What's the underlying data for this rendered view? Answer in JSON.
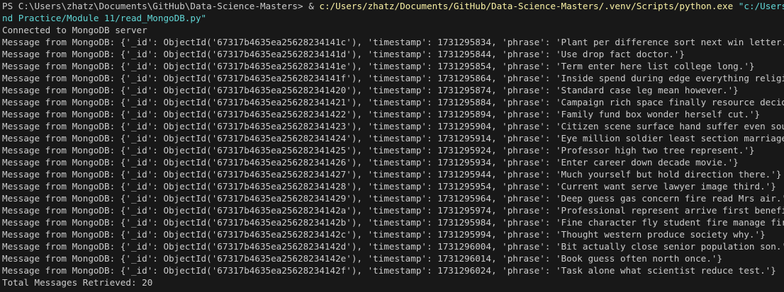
{
  "terminal": {
    "command": {
      "prompt": "PS C:\\Users\\zhatz\\Documents\\GitHub\\Data-Science-Masters> ",
      "operator": "& ",
      "executable": "c:/Users/zhatz/Documents/GitHub/Data-Science-Masters/.venv/Scripts/python.exe",
      "space": " ",
      "arg_line1": "\"c:/Users/zhatz/Docum",
      "arg_line2": "nd Practice/Module 11/read_MongoDB.py\""
    },
    "connected_text": "Connected to MongoDB server",
    "messages": [
      "Message from MongoDB: {'_id': ObjectId('67317b4635ea25628234141c'), 'timestamp': 1731295834, 'phrase': 'Plant per difference sort next win letter.'}",
      "Message from MongoDB: {'_id': ObjectId('67317b4635ea25628234141d'), 'timestamp': 1731295844, 'phrase': 'Use drop fact doctor.'}",
      "Message from MongoDB: {'_id': ObjectId('67317b4635ea25628234141e'), 'timestamp': 1731295854, 'phrase': 'Term enter here list college long.'}",
      "Message from MongoDB: {'_id': ObjectId('67317b4635ea25628234141f'), 'timestamp': 1731295864, 'phrase': 'Inside spend during edge everything religious.'}",
      "Message from MongoDB: {'_id': ObjectId('67317b4635ea256282341420'), 'timestamp': 1731295874, 'phrase': 'Standard case leg mean however.'}",
      "Message from MongoDB: {'_id': ObjectId('67317b4635ea256282341421'), 'timestamp': 1731295884, 'phrase': 'Campaign rich space finally resource decide you.'}",
      "Message from MongoDB: {'_id': ObjectId('67317b4635ea256282341422'), 'timestamp': 1731295894, 'phrase': 'Family fund box wonder herself cut.'}",
      "Message from MongoDB: {'_id': ObjectId('67317b4635ea256282341423'), 'timestamp': 1731295904, 'phrase': 'Citizen scene surface hand suffer even source.'}",
      "Message from MongoDB: {'_id': ObjectId('67317b4635ea256282341424'), 'timestamp': 1731295914, 'phrase': 'Eye million soldier least section marriage animal.'}",
      "Message from MongoDB: {'_id': ObjectId('67317b4635ea256282341425'), 'timestamp': 1731295924, 'phrase': 'Professor high two tree represent.'}",
      "Message from MongoDB: {'_id': ObjectId('67317b4635ea256282341426'), 'timestamp': 1731295934, 'phrase': 'Enter career down decade movie.'}",
      "Message from MongoDB: {'_id': ObjectId('67317b4635ea256282341427'), 'timestamp': 1731295944, 'phrase': 'Much yourself but hold direction there.'}",
      "Message from MongoDB: {'_id': ObjectId('67317b4635ea256282341428'), 'timestamp': 1731295954, 'phrase': 'Current want serve lawyer image third.'}",
      "Message from MongoDB: {'_id': ObjectId('67317b4635ea256282341429'), 'timestamp': 1731295964, 'phrase': 'Deep guess gas concern fire read Mrs air.'}",
      "Message from MongoDB: {'_id': ObjectId('67317b4635ea25628234142a'), 'timestamp': 1731295974, 'phrase': 'Professional represent arrive first benefit.'}",
      "Message from MongoDB: {'_id': ObjectId('67317b4635ea25628234142b'), 'timestamp': 1731295984, 'phrase': 'Fine character fly student fire manage fire.'}",
      "Message from MongoDB: {'_id': ObjectId('67317b4635ea25628234142c'), 'timestamp': 1731295994, 'phrase': 'Thought western produce society why.'}",
      "Message from MongoDB: {'_id': ObjectId('67317b4635ea25628234142d'), 'timestamp': 1731296004, 'phrase': 'Bit actually close senior population son.'}",
      "Message from MongoDB: {'_id': ObjectId('67317b4635ea25628234142e'), 'timestamp': 1731296014, 'phrase': 'Book guess often north once.'}",
      "Message from MongoDB: {'_id': ObjectId('67317b4635ea25628234142f'), 'timestamp': 1731296024, 'phrase': 'Task alone what scientist reduce test.'}"
    ],
    "total_text": "Total Messages Retrieved: 20",
    "colors": {
      "background": "#181818",
      "text": "#cccccc",
      "executable": "#f9f1a5",
      "argument": "#61d6d6"
    }
  }
}
